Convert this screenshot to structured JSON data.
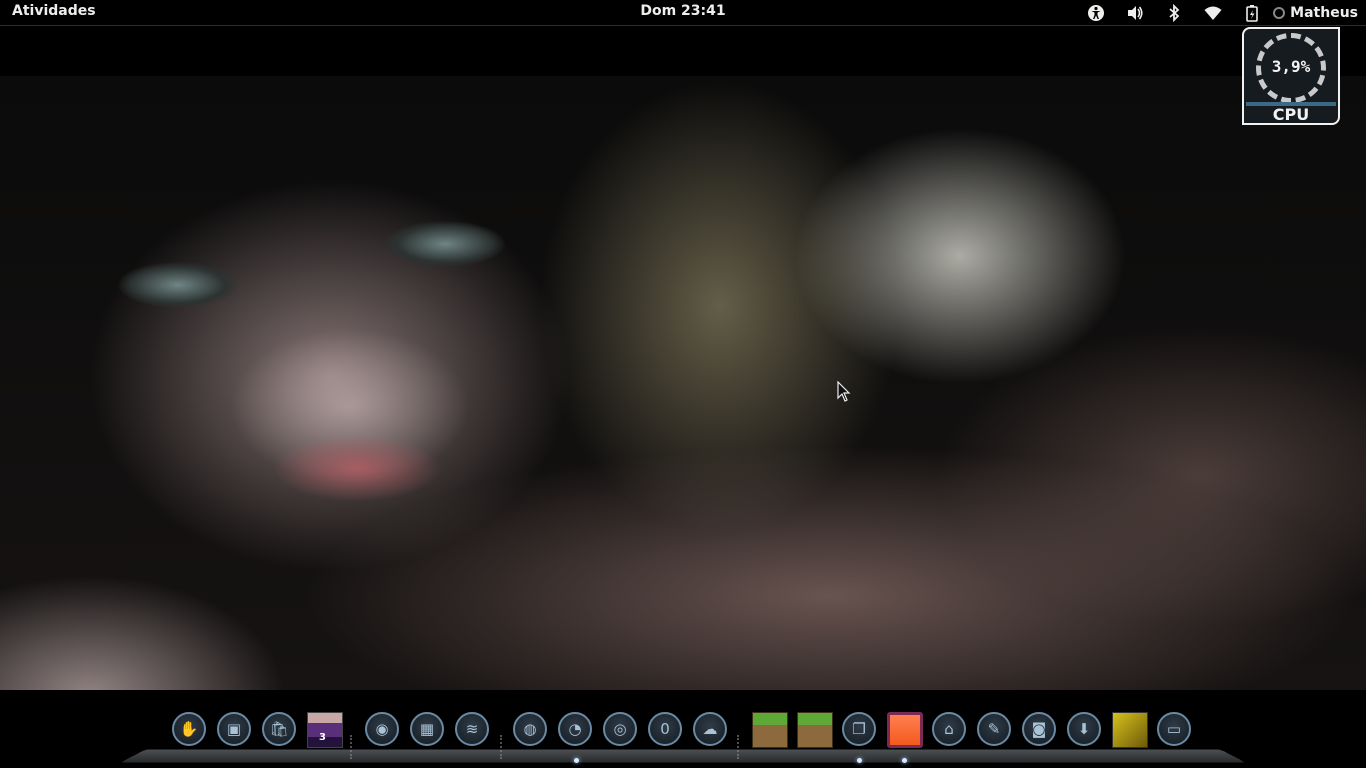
{
  "topbar": {
    "activities_label": "Atividades",
    "clock": "Dom 23:41",
    "user_name": "Matheus",
    "tray_icons": [
      "accessibility-icon",
      "volume-icon",
      "bluetooth-icon",
      "wifi-icon",
      "battery-icon"
    ]
  },
  "cpu_widget": {
    "value": "3,9%",
    "label": "CPU"
  },
  "dock": {
    "items": [
      {
        "name": "gimp-launcher",
        "icon": "paw-icon",
        "glyph": "✋"
      },
      {
        "name": "terminal-launcher",
        "icon": "terminal-icon",
        "glyph": "▣"
      },
      {
        "name": "shopping-launcher",
        "icon": "bag-icon",
        "glyph": "🛍"
      },
      {
        "name": "image-stack-launcher",
        "icon": "image-stack-icon",
        "badge": "3"
      },
      {
        "name": "gimp-alt-launcher",
        "icon": "wilber-icon",
        "glyph": "◉"
      },
      {
        "name": "calculator-launcher",
        "icon": "calculator-icon",
        "glyph": "▦"
      },
      {
        "name": "spotify-launcher",
        "icon": "spotify-icon",
        "glyph": "≋"
      },
      {
        "name": "browser-launcher",
        "icon": "globe-icon",
        "glyph": "◍"
      },
      {
        "name": "firefox-launcher",
        "icon": "firefox-icon",
        "glyph": "◔"
      },
      {
        "name": "chrome-launcher",
        "icon": "chrome-icon",
        "glyph": "◎"
      },
      {
        "name": "opera-launcher",
        "icon": "opera-icon",
        "glyph": "0"
      },
      {
        "name": "skype-launcher",
        "icon": "skype-icon",
        "glyph": "☁"
      },
      {
        "name": "minecraft-launcher-1",
        "icon": "minecraft-grass-icon"
      },
      {
        "name": "minecraft-launcher-2",
        "icon": "minecraft-grass-icon"
      },
      {
        "name": "files-launcher",
        "icon": "folder-icon",
        "glyph": "❐"
      },
      {
        "name": "ubuntu-launcher",
        "icon": "orange-square-icon"
      },
      {
        "name": "home-launcher",
        "icon": "home-icon",
        "glyph": "⌂"
      },
      {
        "name": "text-editor-launcher",
        "icon": "edit-icon",
        "glyph": "✎"
      },
      {
        "name": "screenshot-launcher",
        "icon": "camera-icon",
        "glyph": "◙"
      },
      {
        "name": "downloads-launcher",
        "icon": "download-icon",
        "glyph": "⬇"
      },
      {
        "name": "photo-launcher",
        "icon": "photo-thumbnail-icon"
      },
      {
        "name": "desktop-launcher",
        "icon": "monitor-icon",
        "glyph": "▭"
      }
    ]
  },
  "colors": {
    "panel_bg": "#000000",
    "panel_text": "#eeeeec",
    "dock_accent": "#6a8aa3"
  }
}
